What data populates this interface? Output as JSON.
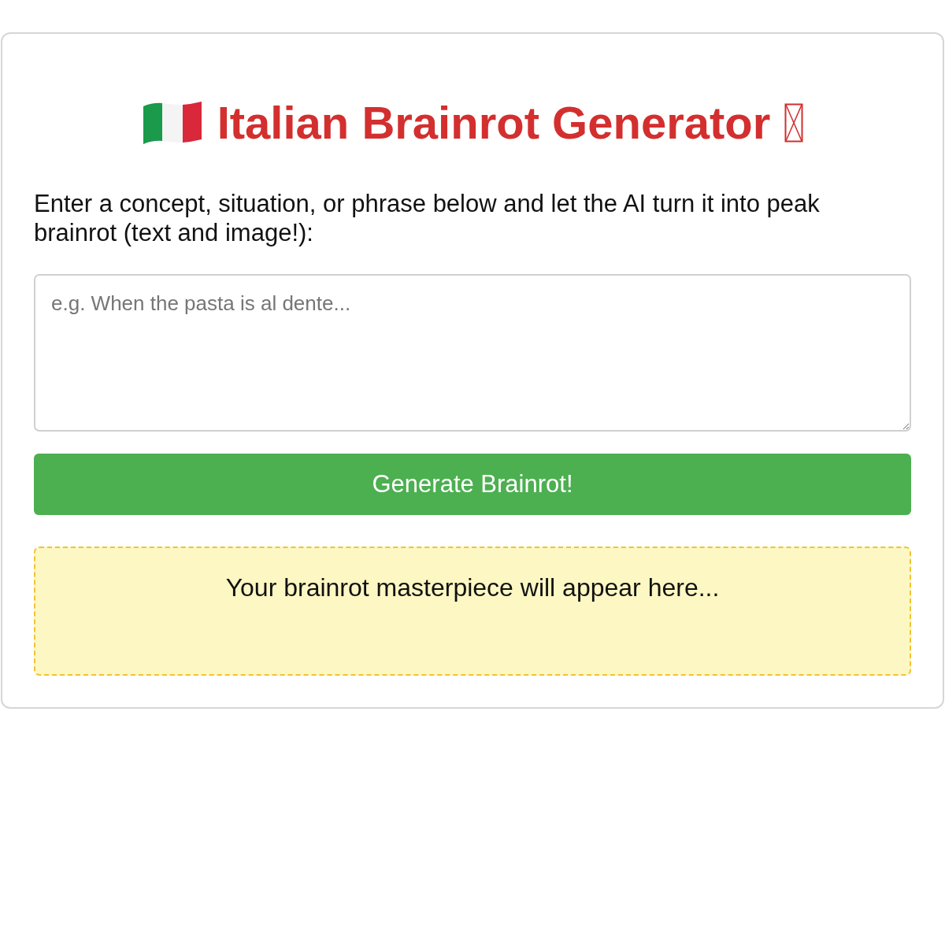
{
  "header": {
    "title": "Italian Brainrot Generator"
  },
  "intro": "Enter a concept, situation, or phrase below and let the AI turn it into peak brainrot (text and image!):",
  "prompt_field": {
    "placeholder": "e.g. When the pasta is al dente..."
  },
  "generate_button": {
    "label": "Generate Brainrot!"
  },
  "output": {
    "message": "Your brainrot masterpiece will appear here..."
  }
}
